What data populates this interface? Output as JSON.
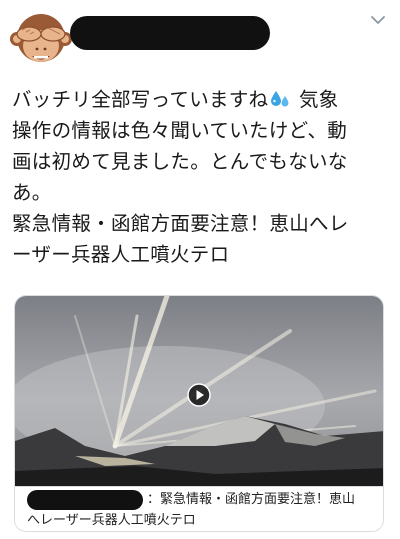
{
  "tweet": {
    "text_lines": [
      "バッチリ全部写っていますね",
      "気象",
      "操作の情報は色々聞いていたけど、動",
      "画は初めて見ました。とんでもないな",
      "あ。",
      "緊急情報・函館方面要注意！恵山へレ",
      "ーザー兵器人工噴火テロ"
    ],
    "emoji": "sweat-droplets-icon"
  },
  "card": {
    "caption_line1": "：緊急情報・函館方面要注意！恵山",
    "caption_line2": "へレーザー兵器人工噴火テロ"
  },
  "icons": {
    "avatar": "see-no-evil-monkey-icon",
    "menu": "chevron-down-icon",
    "play": "play-icon"
  },
  "colors": {
    "text": "#1a1a1a",
    "border": "#d8dde2",
    "redaction": "#111111",
    "emoji_blue": "#3aa3e3"
  }
}
